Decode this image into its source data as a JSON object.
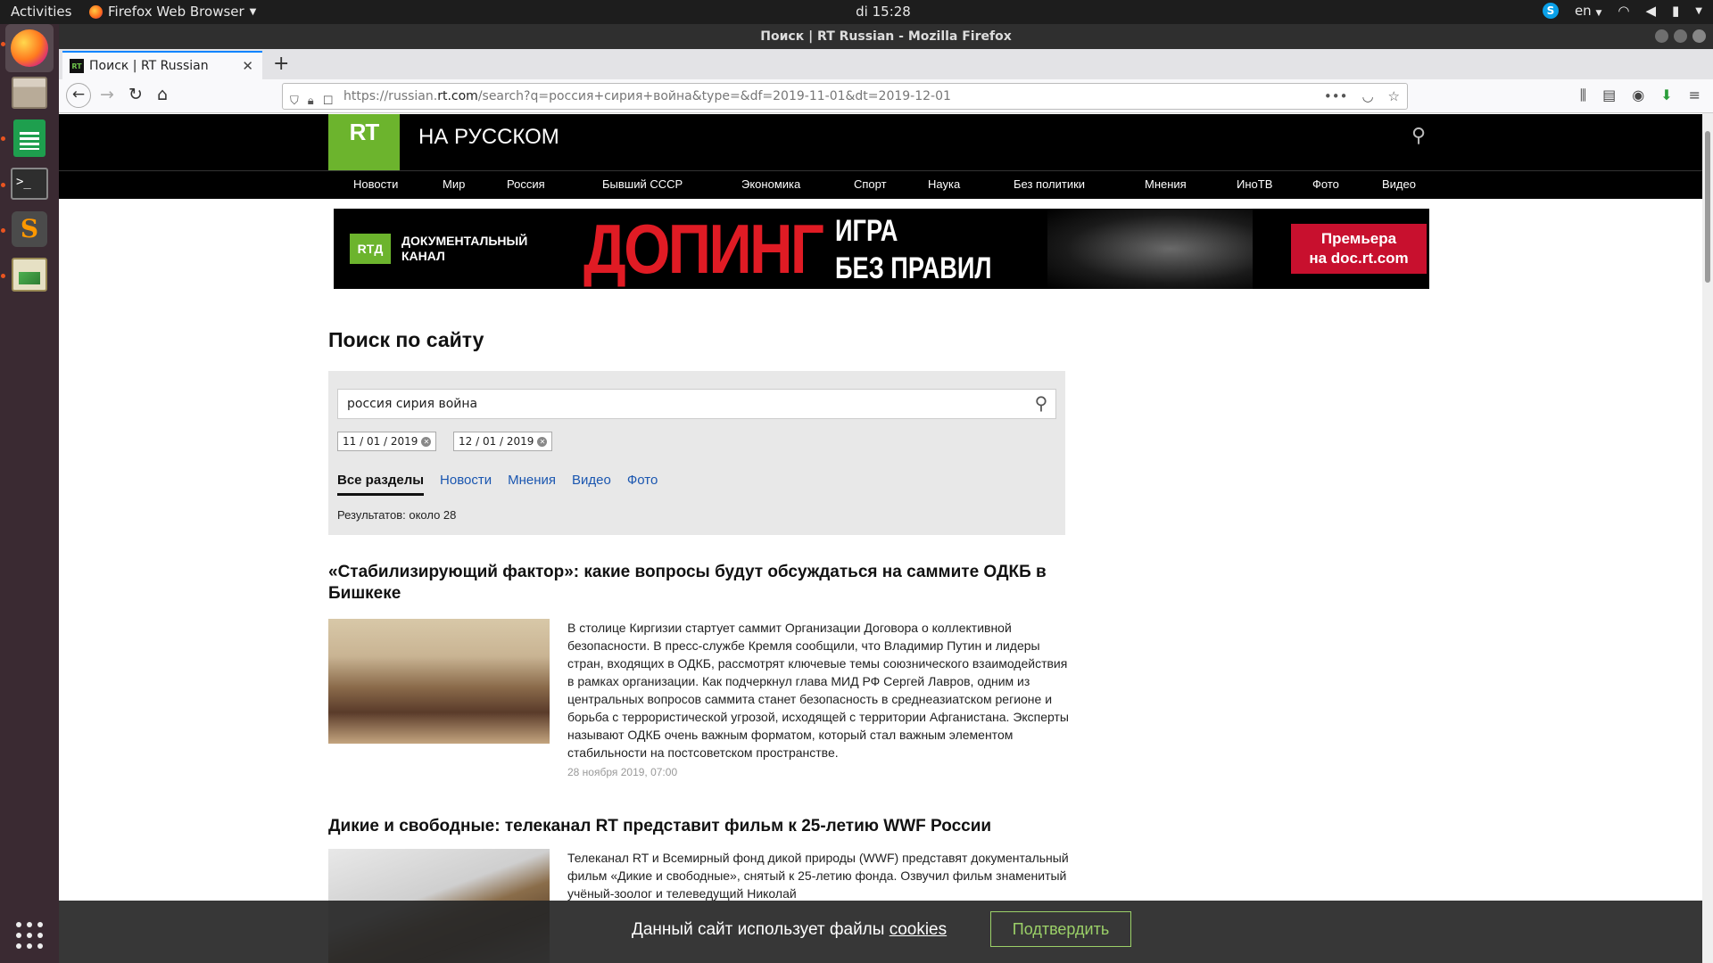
{
  "system": {
    "activities": "Activities",
    "app_menu": "Firefox Web Browser",
    "clock": "di 15:28",
    "lang": "en"
  },
  "browser": {
    "window_title": "Поиск | RT Russian - Mozilla Firefox",
    "tab_title": "Поиск | RT Russian",
    "url_prefix": "https://russian.",
    "url_host": "rt.com",
    "url_rest": "/search?q=россия+сирия+война&type=&df=2019-11-01&dt=2019-12-01"
  },
  "site": {
    "logo": "RT",
    "title": "НА РУССКОМ",
    "nav": [
      "Новости",
      "Мир",
      "Россия",
      "Бывший СССР",
      "Экономика",
      "Спорт",
      "Наука",
      "Без политики",
      "Мнения",
      "ИноТВ",
      "Фото",
      "Видео"
    ]
  },
  "banner": {
    "logo": "RTД",
    "channel_line1": "ДОКУМЕНТАЛЬНЫЙ",
    "channel_line2": "КАНАЛ",
    "headline": "ДОПИНГ",
    "subline1": "ИГРА",
    "subline2": "БЕЗ ПРАВИЛ",
    "cta_line1": "Премьера",
    "cta_line2": "на doc.rt.com"
  },
  "search": {
    "heading": "Поиск по сайту",
    "query": "россия сирия война",
    "date_from": "11 / 01 / 2019",
    "date_to": "12 / 01 / 2019",
    "tabs": [
      "Все разделы",
      "Новости",
      "Мнения",
      "Видео",
      "Фото"
    ],
    "results_count": "Результатов: около 28"
  },
  "results": [
    {
      "title": "«Стабилизирующий фактор»: какие вопросы будут обсуждаться на саммите ОДКБ в Бишкеке",
      "body": "В столице Киргизии стартует саммит Организации Договора о коллективной безопасности. В пресс-службе Кремля сообщили, что Владимир Путин и лидеры стран, входящих в ОДКБ, рассмотрят ключевые темы союзнического взаимодействия в рамках организации. Как подчеркнул глава МИД РФ Сергей Лавров, одним из центральных вопросов саммита станет безопасность в среднеазиатском регионе и борьба с террористической угрозой, исходящей с территории Афганистана. Эксперты называют ОДКБ очень важным форматом, который стал важным элементом стабильности на постсоветском пространстве.",
      "date": "28 ноября 2019, 07:00"
    },
    {
      "title": "Дикие и свободные: телеканал RT представит фильм к 25-летию WWF России",
      "body": "Телеканал RT и Всемирный фонд дикой природы (WWF) представят документальный фильм «Дикие и свободные», снятый к 25-летию фонда. Озвучил фильм знаменитый учёный-зоолог и телеведущий Николай"
    }
  ],
  "cookie": {
    "text": "Данный сайт использует файлы ",
    "link": "cookies",
    "button": "Подтвердить"
  }
}
